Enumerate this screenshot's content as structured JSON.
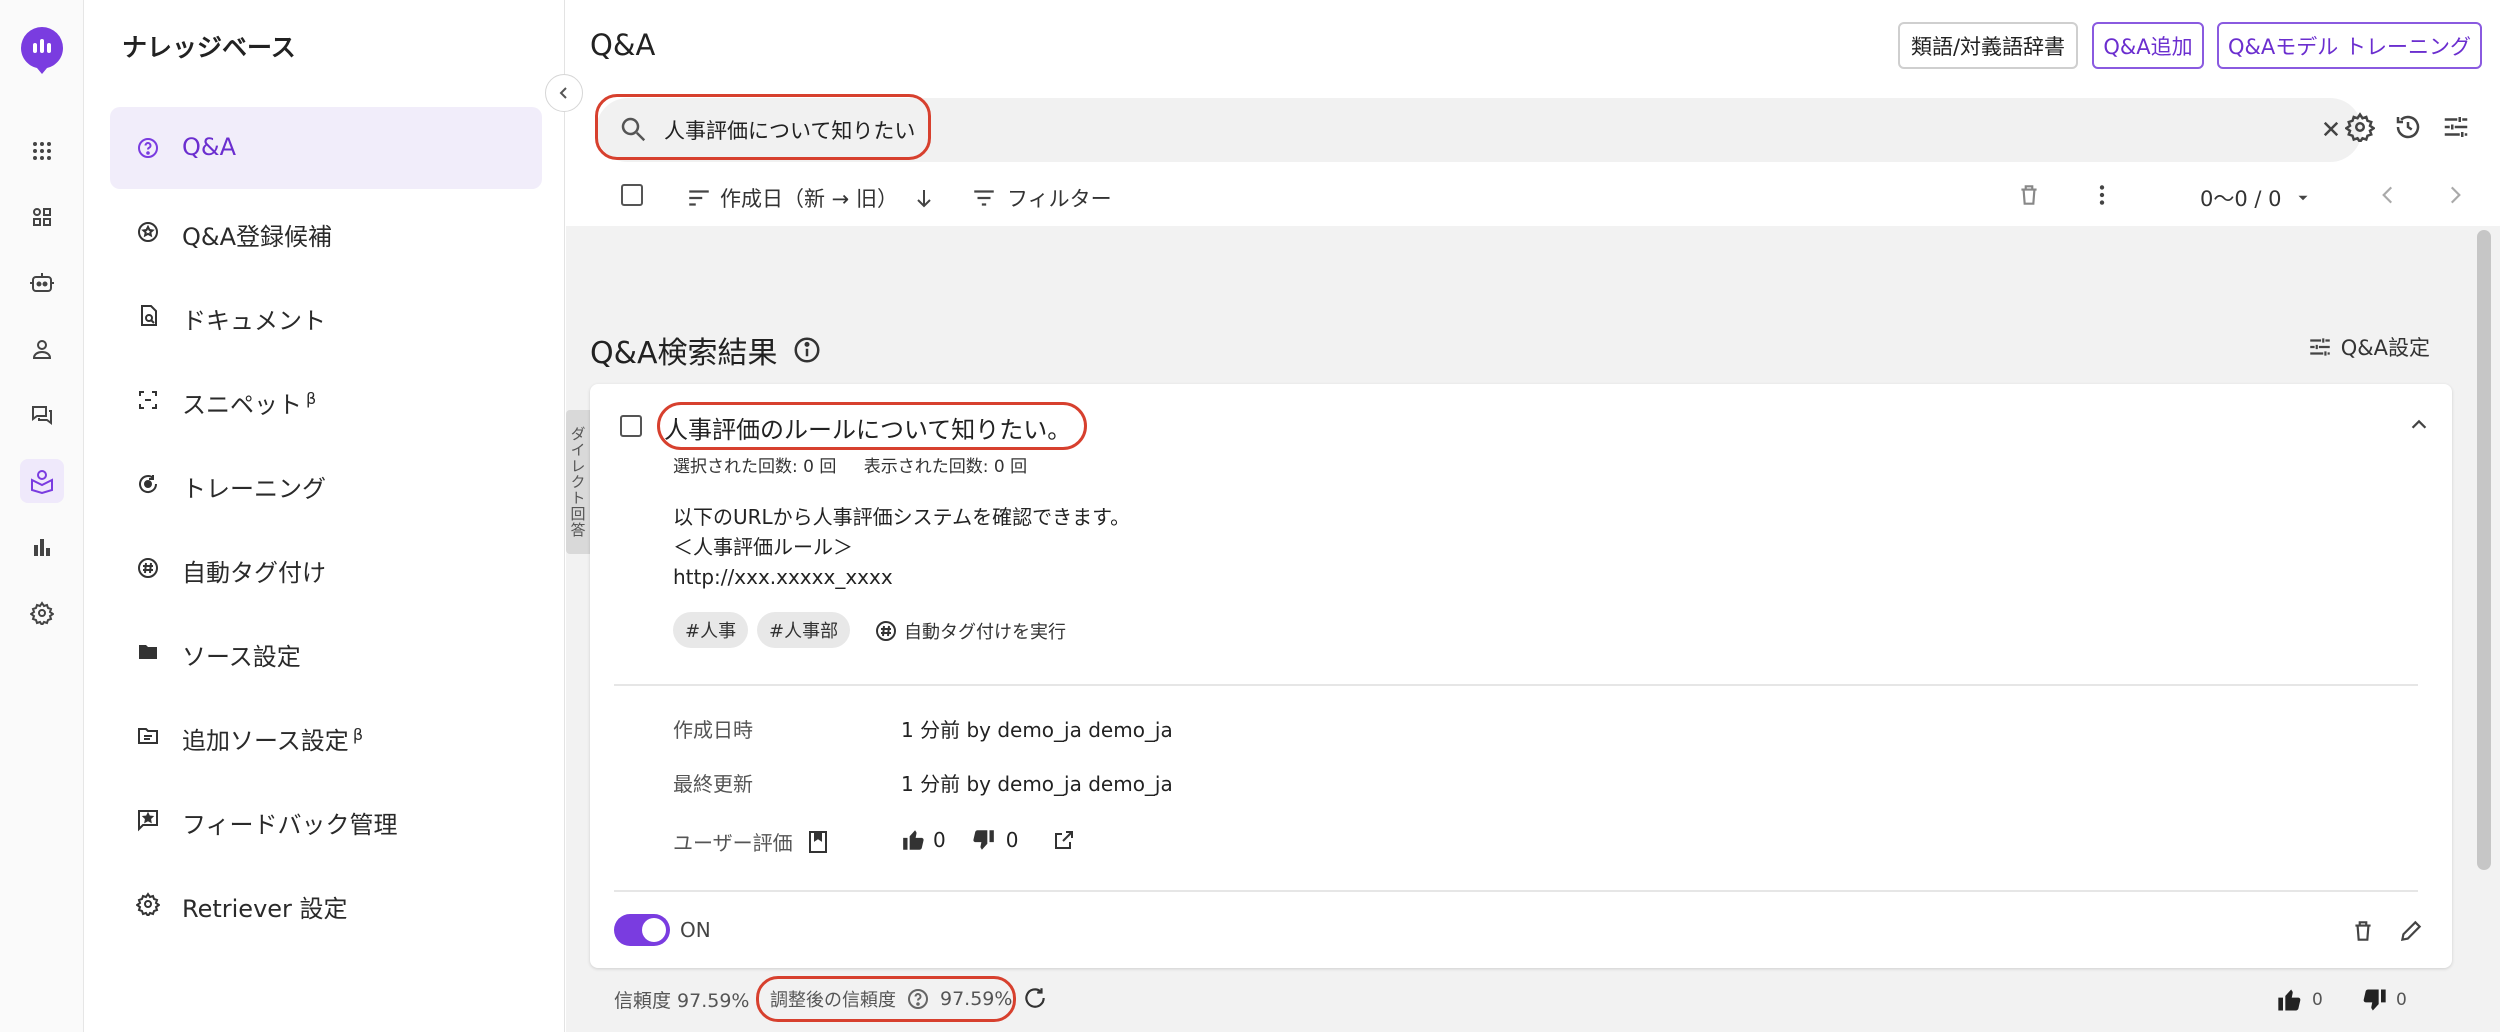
{
  "colors": {
    "accent": "#6b2ecf",
    "highlight": "#d7402e",
    "toggle_on": "#7a3ce0"
  },
  "rail": {
    "icons": [
      "app-logo",
      "apps-grid-icon",
      "widgets-icon",
      "bot-icon",
      "person-icon",
      "chat-icon",
      "knowledge-icon",
      "bar-chart-icon",
      "gear-icon"
    ],
    "active": "knowledge-icon"
  },
  "sidebar": {
    "title": "ナレッジベース",
    "items": [
      {
        "label": "Q&A",
        "icon": "qa-icon",
        "active": true
      },
      {
        "label": "Q&A登録候補",
        "icon": "candidate-icon"
      },
      {
        "label": "ドキュメント",
        "icon": "document-search-icon"
      },
      {
        "label": "スニペット",
        "sup": "β",
        "icon": "snippet-icon"
      },
      {
        "label": "トレーニング",
        "icon": "training-icon"
      },
      {
        "label": "自動タグ付け",
        "icon": "hashtag-icon"
      },
      {
        "label": "ソース設定",
        "icon": "folder-icon"
      },
      {
        "label": "追加ソース設定",
        "sup": "β",
        "icon": "folder-outline-icon"
      },
      {
        "label": "フィードバック管理",
        "icon": "feedback-icon"
      },
      {
        "label": "Retriever 設定",
        "icon": "retriever-gear-icon"
      }
    ]
  },
  "header": {
    "title": "Q&A",
    "buttons": {
      "dictionary": "類語/対義語辞書",
      "add_qa": "Q&A追加",
      "train_model": "Q&Aモデル トレーニング"
    }
  },
  "search": {
    "value": "人事評価について知りたい",
    "placeholder": ""
  },
  "toolbar": {
    "sort_label": "作成日（新 → 旧）",
    "filter_label": "フィルター",
    "pagination": "0〜0 / 0"
  },
  "results": {
    "title": "Q&A検索結果",
    "settings_label": "Q&A設定",
    "direct_tab": "ダイレクト回答",
    "card": {
      "question": "人事評価のルールについて知りたい。",
      "selected_count": "選択された回数: 0 回",
      "shown_count": "表示された回数: 0 回",
      "answer_lines": [
        "以下のURLから人事評価システムを確認できます。",
        "＜人事評価ルール＞",
        "http://xxx.xxxxx_xxxx"
      ],
      "tags": [
        "#人事",
        "#人事部"
      ],
      "autotag_label": "自動タグ付けを実行",
      "created_label": "作成日時",
      "created_value": "1 分前 by demo_ja demo_ja",
      "updated_label": "最終更新",
      "updated_value": "1 分前 by demo_ja demo_ja",
      "rating_label": "ユーザー評価",
      "likes": "0",
      "dislikes": "0",
      "toggle_label": "ON",
      "toggle_on": true
    },
    "footer": {
      "confidence": "信頼度 97.59%",
      "adjusted_label": "調整後の信頼度",
      "adjusted_value": "97.59%",
      "likes": "0",
      "dislikes": "0"
    }
  }
}
